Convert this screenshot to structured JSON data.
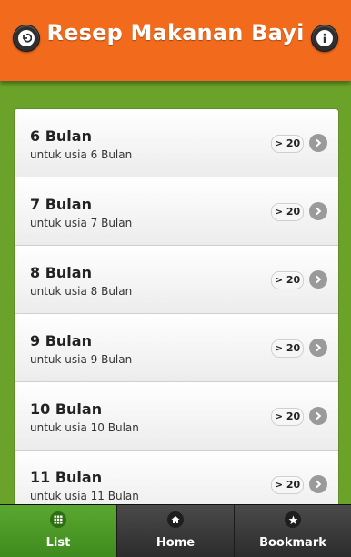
{
  "header": {
    "title": "Resep Makanan Bayi",
    "back_icon": "back-arrow-icon",
    "info_icon": "info-icon",
    "color": "#f26b1d"
  },
  "list": {
    "items": [
      {
        "title": "6 Bulan",
        "subtitle": "untuk usia 6 Bulan",
        "count": "> 20"
      },
      {
        "title": "7 Bulan",
        "subtitle": "untuk usia 7 Bulan",
        "count": "> 20"
      },
      {
        "title": "8 Bulan",
        "subtitle": "untuk usia 8 Bulan",
        "count": "> 20"
      },
      {
        "title": "9 Bulan",
        "subtitle": "untuk usia 9 Bulan",
        "count": "> 20"
      },
      {
        "title": "10 Bulan",
        "subtitle": "untuk usia 10 Bulan",
        "count": "> 20"
      },
      {
        "title": "11 Bulan",
        "subtitle": "untuk usia 11 Bulan",
        "count": "> 20"
      }
    ]
  },
  "tabs": [
    {
      "label": "List",
      "icon": "grid-icon",
      "active": true
    },
    {
      "label": "Home",
      "icon": "home-icon",
      "active": false
    },
    {
      "label": "Bookmark",
      "icon": "star-icon",
      "active": false
    }
  ],
  "colors": {
    "background": "#6aa22a",
    "active_tab": "#4f9e28"
  }
}
